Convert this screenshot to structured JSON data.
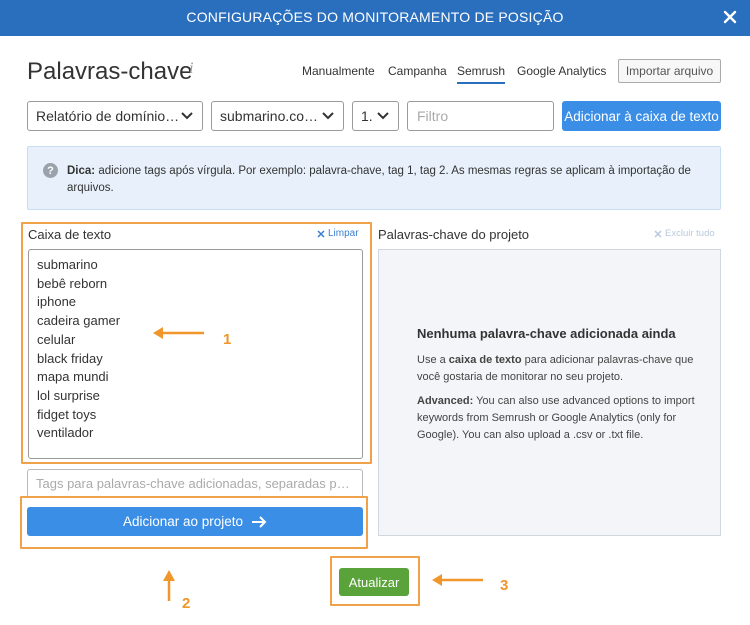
{
  "header": {
    "title": "CONFIGURAÇÕES DO MONITORAMENTO DE POSIÇÃO",
    "close_icon": "close-icon"
  },
  "page": {
    "title": "Palavras-chave",
    "info_icon": "i"
  },
  "tabs": [
    {
      "label": "Manualmente",
      "active": false
    },
    {
      "label": "Campanha",
      "active": false
    },
    {
      "label": "Semrush",
      "active": true
    },
    {
      "label": "Google Analytics",
      "active": false
    }
  ],
  "import_button": "Importar arquivo",
  "controls": {
    "report_select": "Relatório de domínio…",
    "domain_select": "submarino.co…",
    "position_select": "1.",
    "filter_placeholder": "Filtro",
    "add_to_box_button": "Adicionar à caixa de texto"
  },
  "tip": {
    "label": "Dica:",
    "text": "adicione tags após vírgula. Por exemplo: palavra-chave, tag 1, tag 2. As mesmas regras se aplicam à importação de arquivos."
  },
  "textbox": {
    "label": "Caixa de texto",
    "clear_label": "Limpar",
    "keywords": [
      "submarino",
      "bebê reborn",
      "iphone",
      "cadeira gamer",
      "celular",
      "black friday",
      "mapa mundi",
      "lol surprise",
      "fidget toys",
      "ventilador"
    ],
    "tags_placeholder": "Tags para palavras-chave adicionadas, separadas p…",
    "add_to_project_button": "Adicionar ao projeto"
  },
  "project_keywords": {
    "label": "Palavras-chave do projeto",
    "delete_all_label": "Excluir tudo",
    "empty_title": "Nenhuma palavra-chave adicionada ainda",
    "empty_text_prefix": "Use a ",
    "empty_text_bold": "caixa de texto",
    "empty_text_suffix": " para adicionar palavras-chave que você gostaria de monitorar no seu projeto.",
    "advanced_bold": "Advanced:",
    "advanced_text": " You can also use advanced options to import keywords from Semrush or Google Analytics (only for Google). You can also upload a .csv or .txt file."
  },
  "update_button": "Atualizar",
  "annotations": {
    "num1": "1",
    "num2": "2",
    "num3": "3"
  },
  "colors": {
    "header_bg": "#2a6fbe",
    "primary_button": "#3a8ee6",
    "update_button": "#5aa23a",
    "annotation_orange": "#f0a24a"
  }
}
